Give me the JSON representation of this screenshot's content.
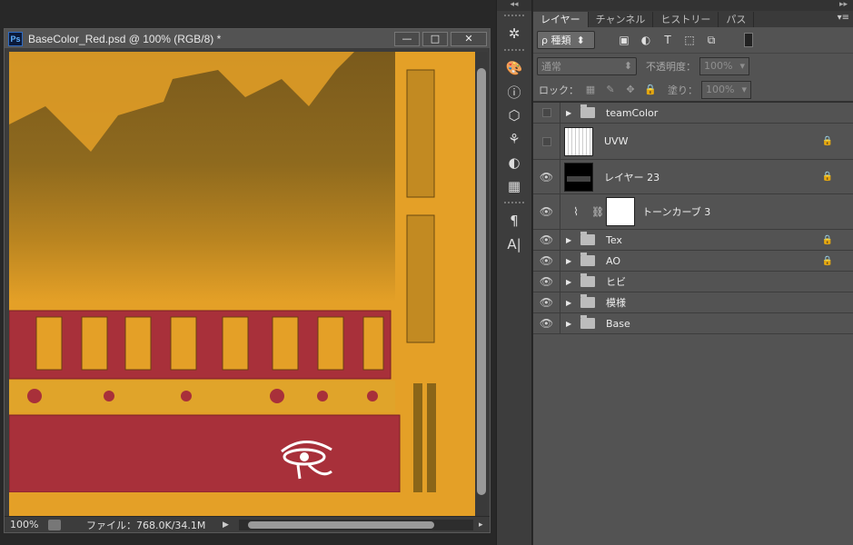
{
  "document": {
    "title": "BaseColor_Red.psd @ 100% (RGB/8) *",
    "ps_badge": "Ps",
    "minimize": "—",
    "maximize": "□",
    "close": "✕",
    "zoom": "100%",
    "file_info": "ファイル：768.0K/34.1M",
    "status_arrow": "▶",
    "scroll_right": "▸"
  },
  "tools": {
    "collapse": "◂◂"
  },
  "panel": {
    "collapse": "▸▸",
    "menu": "▾≡",
    "tabs": [
      "レイヤー",
      "チャンネル",
      "ヒストリー",
      "パス"
    ],
    "filter_kind": "ρ 種類",
    "filter_arrow": "⬍",
    "blend_mode": "通常",
    "blend_arrow": "⬍",
    "opacity_label": "不透明度：",
    "opacity_value": "100%",
    "lock_label": "ロック：",
    "fill_label": "塗り：",
    "fill_value": "100%",
    "dropdown_arrow": "▾"
  },
  "layers": [
    {
      "name": "teamColor",
      "type": "group",
      "visible": false,
      "locked": false
    },
    {
      "name": "UVW",
      "type": "image-uvw",
      "visible": false,
      "locked": true
    },
    {
      "name": "レイヤー 23",
      "type": "image-black",
      "visible": true,
      "locked": true
    },
    {
      "name": "トーンカーブ 3",
      "type": "adjustment",
      "visible": true,
      "locked": false
    },
    {
      "name": "Tex",
      "type": "group",
      "visible": true,
      "locked": true
    },
    {
      "name": "AO",
      "type": "group",
      "visible": true,
      "locked": true
    },
    {
      "name": "ヒビ",
      "type": "group",
      "visible": true,
      "locked": false
    },
    {
      "name": "模様",
      "type": "group",
      "visible": true,
      "locked": false
    },
    {
      "name": "Base",
      "type": "group",
      "visible": true,
      "locked": false
    }
  ],
  "icons": {
    "eye": "👁",
    "lock": "🔒",
    "disclosure": "▶"
  },
  "colors": {
    "texture_yellow": "#e4a027",
    "texture_red": "#a42c34",
    "panel_bg": "#535353"
  }
}
